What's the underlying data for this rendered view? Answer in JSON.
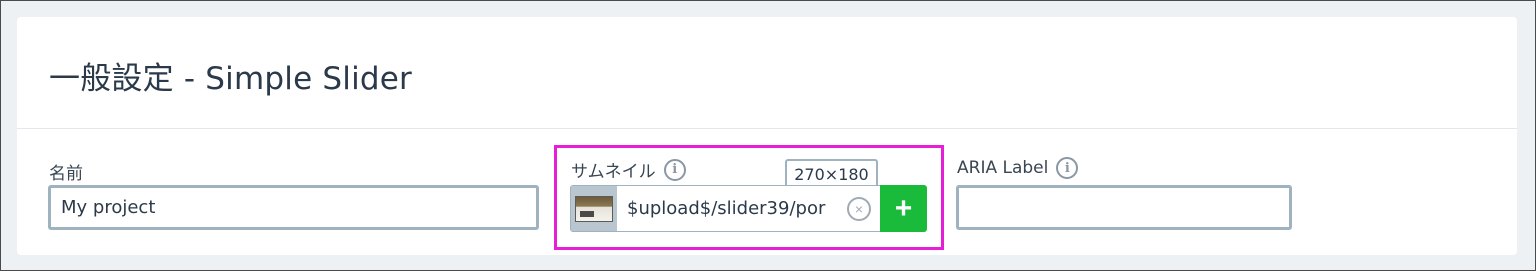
{
  "header": {
    "title": "一般設定 - Simple Slider"
  },
  "fields": {
    "name": {
      "label": "名前",
      "value": "My project"
    },
    "thumbnail": {
      "label": "サムネイル",
      "value": "$upload$/slider39/por",
      "size": "270×180",
      "clear_icon": "close-circle-icon",
      "add_icon": "plus-icon",
      "add_label": "+",
      "clear_label": "×"
    },
    "aria": {
      "label": "ARIA Label",
      "value": ""
    }
  },
  "info_icon_glyph": "i",
  "colors": {
    "accent_add": "#1aba3b",
    "highlight": "#e61ed8",
    "input_border": "#9fb2c0"
  }
}
